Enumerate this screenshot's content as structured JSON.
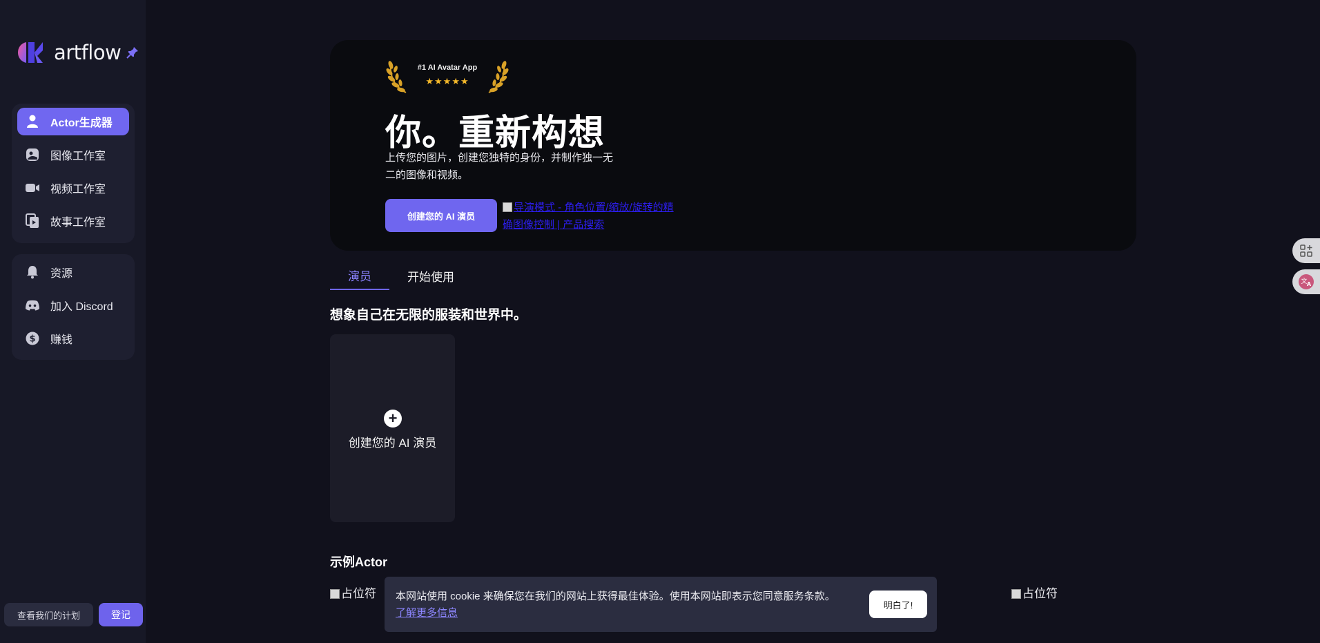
{
  "sidebar": {
    "logo_text": "artflow",
    "group1": [
      {
        "label": "Actor生成器",
        "icon": "user-icon",
        "active": true
      },
      {
        "label": "图像工作室",
        "icon": "image-studio-icon"
      },
      {
        "label": "视频工作室",
        "icon": "video-camera-icon"
      },
      {
        "label": "故事工作室",
        "icon": "story-icon"
      }
    ],
    "group2": [
      {
        "label": "资源",
        "icon": "bell-icon"
      },
      {
        "label": "加入 Discord",
        "icon": "discord-icon"
      },
      {
        "label": "赚钱",
        "icon": "dollar-icon"
      }
    ],
    "plans_label": "查看我们的计划",
    "signup_label": "登记"
  },
  "hero": {
    "badge_title": "#1 AI Avatar App",
    "badge_stars": "★★★★★",
    "title": "你。重新构想",
    "subtitle": "上传您的图片，创建您独特的身份，并制作独一无二的图像和视频。",
    "cta_label": "创建您的 AI 演员",
    "link_text": "导演模式 - 角色位置/缩放/旋转的精确图像控制 | 产品搜索"
  },
  "tabs": [
    {
      "label": "演员",
      "active": true
    },
    {
      "label": "开始使用",
      "active": false
    }
  ],
  "main": {
    "section_title": "想象自己在无限的服装和世界中。",
    "create_card_label": "创建您的 AI 演员",
    "examples_title": "示例Actor",
    "placeholder_alt": "占位符"
  },
  "cookie": {
    "text": "本网站使用 cookie 来确保您在我们的网站上获得最佳体验。使用本网站即表示您同意服务条款。",
    "link": "了解更多信息",
    "button": "明白了!"
  },
  "colors": {
    "accent": "#6f66ef",
    "background": "#11111c",
    "sidebar": "#171826",
    "hero": "#0a0b0f",
    "star": "#f4b82a"
  }
}
